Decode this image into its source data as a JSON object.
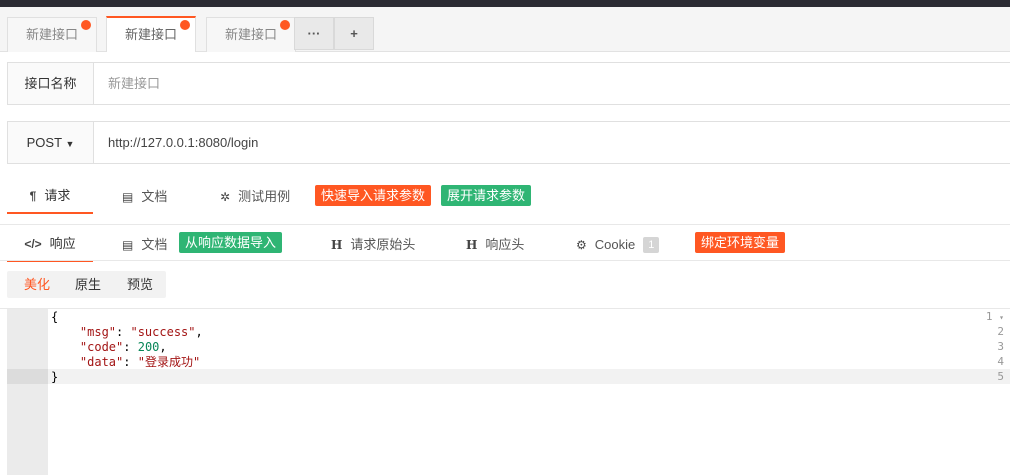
{
  "tabs": [
    {
      "label": "新建接口",
      "modified": true
    },
    {
      "label": "新建接口",
      "modified": true,
      "active": true
    },
    {
      "label": "新建接口",
      "modified": true
    }
  ],
  "tab_actions": {
    "more": "···",
    "add": "+"
  },
  "name_row": {
    "label": "接口名称",
    "placeholder": "新建接口"
  },
  "url_row": {
    "method": "POST",
    "url": "http://127.0.0.1:8080/login"
  },
  "request_menu": {
    "items": [
      {
        "icon": "¶",
        "label": "请求"
      },
      {
        "icon": "▤",
        "label": "文档"
      },
      {
        "icon": "✲",
        "label": "测试用例"
      }
    ],
    "quick_import": "快速导入请求参数",
    "expand_params": "展开请求参数"
  },
  "response_menu": {
    "items": [
      {
        "icon": "</>",
        "label": "响应"
      },
      {
        "icon": "▤",
        "label": "文档"
      },
      {
        "icon": "H",
        "label": "请求原始头"
      },
      {
        "icon": "H",
        "label": "响应头"
      },
      {
        "icon": "⚙",
        "label": "Cookie",
        "count": "1"
      }
    ],
    "import_from_response": "从响应数据导入",
    "bind_env": "绑定环境变量"
  },
  "view_tabs": [
    "美化",
    "原生",
    "预览"
  ],
  "response_body": {
    "line_numbers": [
      "1",
      "2",
      "3",
      "4",
      "5"
    ],
    "fold_marker": "▾",
    "lines": [
      {
        "text": "{"
      },
      {
        "key": "\"msg\"",
        "value": "\"success\"",
        "type": "string",
        "trail": ","
      },
      {
        "key": "\"code\"",
        "value": "200",
        "type": "number",
        "trail": ","
      },
      {
        "key": "\"data\"",
        "value": "\"登录成功\"",
        "type": "string",
        "trail": ""
      },
      {
        "text": "}"
      }
    ]
  },
  "colors": {
    "accent": "#ff5722",
    "success": "#2fb574"
  }
}
